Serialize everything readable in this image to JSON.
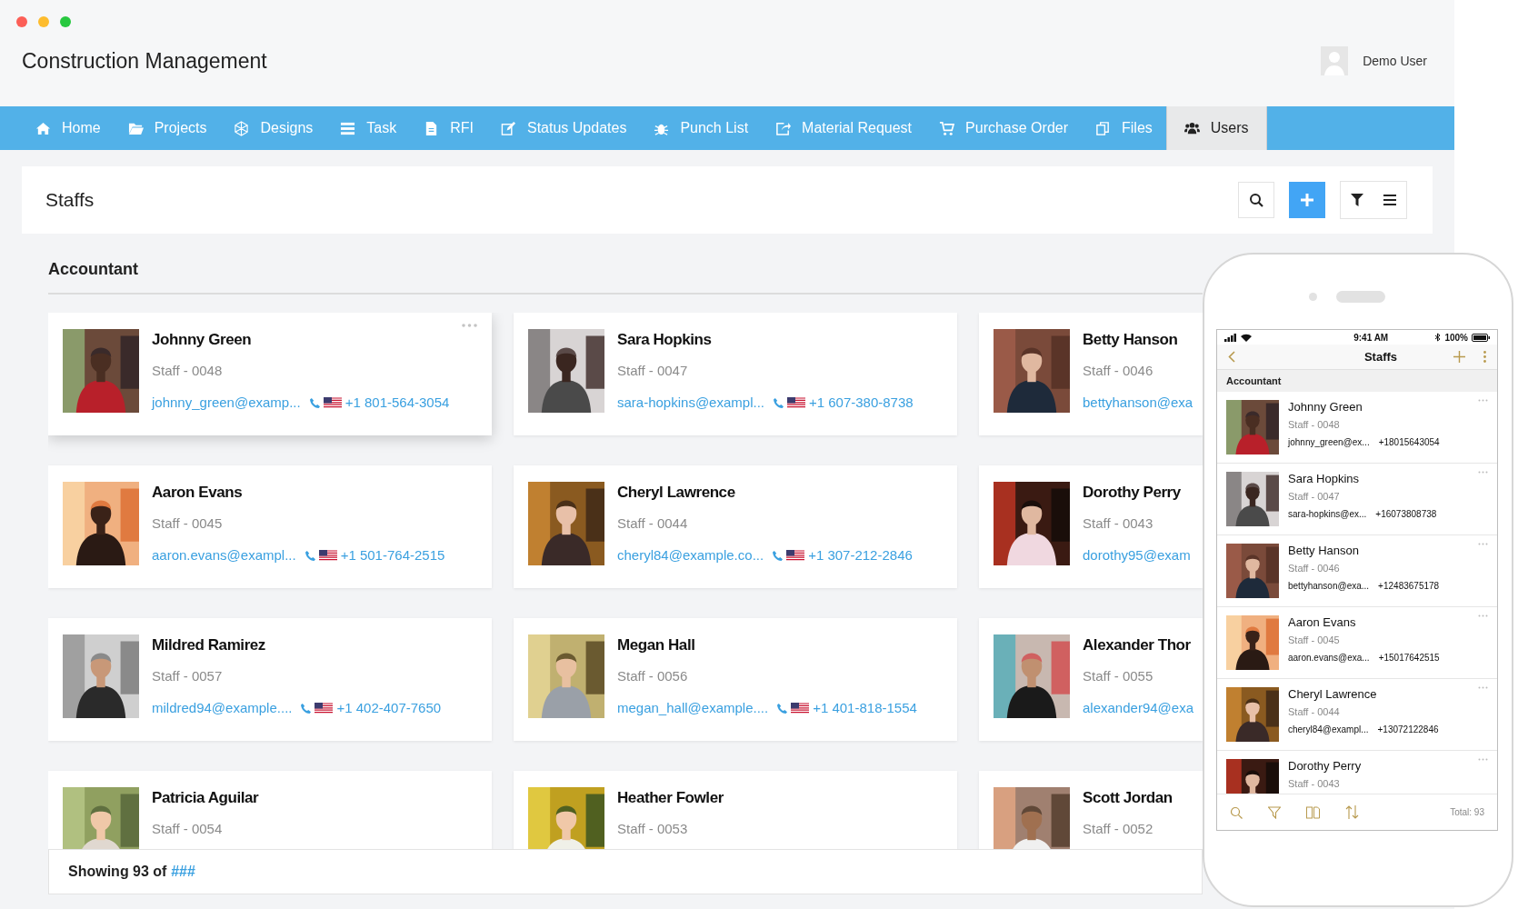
{
  "window": {
    "app_title": "Construction Management",
    "user": {
      "name": "Demo User"
    }
  },
  "nav": [
    {
      "label": "Home",
      "selected": false
    },
    {
      "label": "Projects",
      "selected": false
    },
    {
      "label": "Designs",
      "selected": false
    },
    {
      "label": "Task",
      "selected": false
    },
    {
      "label": "RFI",
      "selected": false
    },
    {
      "label": "Status Updates",
      "selected": false
    },
    {
      "label": "Punch List",
      "selected": false
    },
    {
      "label": "Material Request",
      "selected": false
    },
    {
      "label": "Purchase Order",
      "selected": false
    },
    {
      "label": "Files",
      "selected": false
    },
    {
      "label": "Users",
      "selected": true
    }
  ],
  "panel": {
    "title": "Staffs",
    "group": "Accountant",
    "cards": [
      {
        "name": "Johnny Green",
        "staff_id": "Staff - 0048",
        "email": "johnny_green@examp...",
        "phone": "+1 801-564-3054",
        "selected": true
      },
      {
        "name": "Sara Hopkins",
        "staff_id": "Staff - 0047",
        "email": "sara-hopkins@exampl...",
        "phone": "+1 607-380-8738",
        "selected": false
      },
      {
        "name": "Betty Hanson",
        "staff_id": "Staff - 0046",
        "email": "bettyhanson@exa",
        "selected": false
      },
      {
        "name": "Aaron Evans",
        "staff_id": "Staff - 0045",
        "email": "aaron.evans@exampl...",
        "phone": "+1 501-764-2515",
        "selected": false
      },
      {
        "name": "Cheryl Lawrence",
        "staff_id": "Staff - 0044",
        "email": "cheryl84@example.co...",
        "phone": "+1 307-212-2846",
        "selected": false
      },
      {
        "name": "Dorothy Perry",
        "staff_id": "Staff - 0043",
        "email": "dorothy95@exam",
        "selected": false
      },
      {
        "name": "Mildred Ramirez",
        "staff_id": "Staff - 0057",
        "email": "mildred94@example....",
        "phone": "+1 402-407-7650",
        "selected": false
      },
      {
        "name": "Megan Hall",
        "staff_id": "Staff - 0056",
        "email": "megan_hall@example....",
        "phone": "+1 401-818-1554",
        "selected": false
      },
      {
        "name": "Alexander Thor",
        "staff_id": "Staff - 0055",
        "email": "alexander94@exa",
        "selected": false
      },
      {
        "name": "Patricia Aguilar",
        "staff_id": "Staff - 0054",
        "selected": false
      },
      {
        "name": "Heather Fowler",
        "staff_id": "Staff - 0053",
        "selected": false
      },
      {
        "name": "Scott Jordan",
        "staff_id": "Staff - 0052",
        "selected": false
      }
    ],
    "footer": {
      "text": "Showing 93 of",
      "link": "###"
    }
  },
  "phone": {
    "time": "9:41 AM",
    "battery": "100%",
    "title": "Staffs",
    "section": "Accountant",
    "rows": [
      {
        "name": "Johnny Green",
        "staff_id": "Staff - 0048",
        "email": "johnny_green@ex...",
        "phone": "+18015643054"
      },
      {
        "name": "Sara Hopkins",
        "staff_id": "Staff - 0047",
        "email": "sara-hopkins@ex...",
        "phone": "+16073808738"
      },
      {
        "name": "Betty Hanson",
        "staff_id": "Staff - 0046",
        "email": "bettyhanson@exa...",
        "phone": "+12483675178"
      },
      {
        "name": "Aaron Evans",
        "staff_id": "Staff - 0045",
        "email": "aaron.evans@exa...",
        "phone": "+15017642515"
      },
      {
        "name": "Cheryl Lawrence",
        "staff_id": "Staff - 0044",
        "email": "cheryl84@exampl...",
        "phone": "+13072122846"
      },
      {
        "name": "Dorothy Perry",
        "staff_id": "Staff - 0043"
      }
    ],
    "total": "Total: 93"
  }
}
